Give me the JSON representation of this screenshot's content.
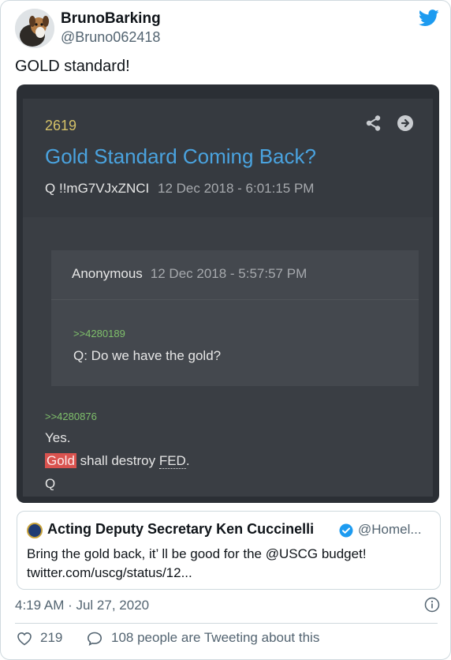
{
  "tweet": {
    "display_name": "BrunoBarking",
    "handle": "@Bruno062418",
    "text": "GOLD standard!",
    "timestamp": "4:19 AM · Jul 27, 2020",
    "likes": "219",
    "tweeting": "108 people are Tweeting about this"
  },
  "qpost": {
    "number": "2619",
    "title": "Gold Standard Coming Back?",
    "author": "Q",
    "trip": "!!mG7VJxZNCI",
    "date": "12 Dec 2018 - 6:01:15 PM",
    "quoted": {
      "author": "Anonymous",
      "date": "12 Dec 2018 - 5:57:57 PM",
      "ref": ">>4280189",
      "body": "Q: Do we have the gold?"
    },
    "reply_ref": ">>4280876",
    "reply_line1": "Yes.",
    "reply_gold": "Gold",
    "reply_mid": " shall destroy ",
    "reply_fed": "FED",
    "reply_end": ".",
    "reply_sign": "Q"
  },
  "quote_tweet": {
    "name": "Acting Deputy Secretary Ken Cuccinelli",
    "handle": "@Homel...",
    "text": "Bring the gold back, it’ ll be good for the @USCG budget! twitter.com/uscg/status/12..."
  },
  "icons": {
    "brand": "twitter-bird-icon",
    "share": "share-icon",
    "next": "arrow-right-icon",
    "verified": "verified-badge-icon",
    "info": "info-icon",
    "like": "heart-icon",
    "reply": "chat-bubble-icon"
  },
  "colors": {
    "twitter_blue": "#1d9bf0",
    "post_number": "#d4c168",
    "post_title": "#4aa3df",
    "greentext": "#7fc06b",
    "highlight": "#d9534f",
    "panel": "#2b2f35"
  }
}
